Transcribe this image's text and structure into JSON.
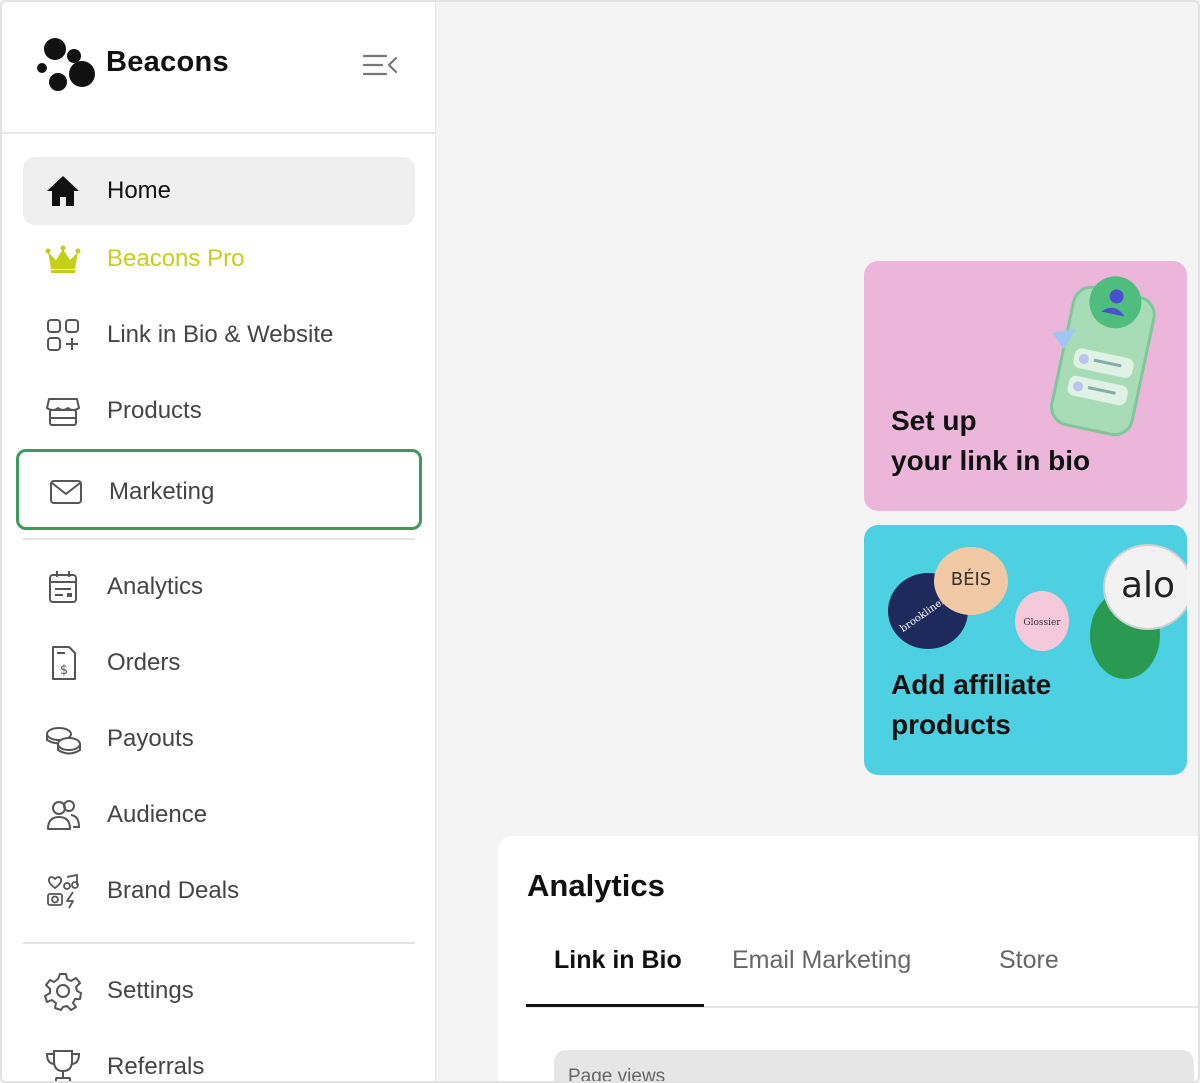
{
  "brand": {
    "name": "Beacons",
    "logo_icon": "beacons-dots-logo",
    "collapse_icon": "collapse-sidebar-icon"
  },
  "sidebar": {
    "items": [
      {
        "label": "Home",
        "icon": "home-icon"
      },
      {
        "label": "Beacons Pro",
        "icon": "crown-icon",
        "color": "#c5cf1a"
      },
      {
        "label": "Link in Bio & Website",
        "icon": "grid-plus-icon"
      },
      {
        "label": "Products",
        "icon": "storefront-icon"
      },
      {
        "label": "Marketing",
        "icon": "envelope-icon"
      },
      {
        "label": "Analytics",
        "icon": "calendar-chart-icon"
      },
      {
        "label": "Orders",
        "icon": "receipt-dollar-icon"
      },
      {
        "label": "Payouts",
        "icon": "coins-icon"
      },
      {
        "label": "Audience",
        "icon": "users-icon"
      },
      {
        "label": "Brand Deals",
        "icon": "brand-deals-icon"
      },
      {
        "label": "Settings",
        "icon": "gear-icon"
      },
      {
        "label": "Referrals",
        "icon": "trophy-icon"
      }
    ]
  },
  "cards": {
    "link_in_bio": {
      "line1": "Set up",
      "line2": "your link in bio",
      "bg": "#ecb6db"
    },
    "affiliate": {
      "line1": "Add affiliate",
      "line2": "products",
      "bg": "#4dd1e2",
      "chip_beis": "BÉIS",
      "chip_alo": "alo",
      "chip_brooklinen": "brooklinen",
      "chip_glossier": "Glossier"
    }
  },
  "analytics": {
    "title": "Analytics",
    "tabs": [
      {
        "label": "Link in Bio"
      },
      {
        "label": "Email Marketing"
      },
      {
        "label": "Store"
      }
    ],
    "metric_label": "Page views"
  },
  "colors": {
    "focus_outline": "#3a9b5c",
    "active_bg": "#efefef"
  }
}
